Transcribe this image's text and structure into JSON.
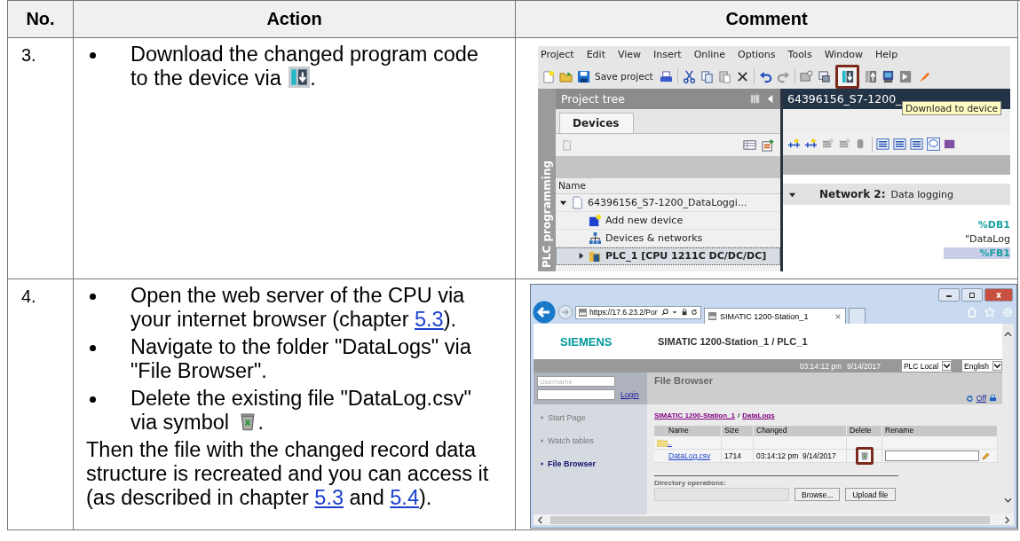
{
  "table": {
    "columns": [
      "No.",
      "Action",
      "Comment"
    ],
    "rows": [
      {
        "number": "3.",
        "bullets": [
          [
            {
              "kind": "text",
              "text": "Download the changed program code to the device via "
            },
            {
              "kind": "icon"
            },
            {
              "kind": "text",
              "text": "."
            }
          ]
        ],
        "paragraphs": [],
        "comment": {
          "kind": "tia",
          "menu": [
            "Project",
            "Edit",
            "View",
            "Insert",
            "Online",
            "Options",
            "Tools",
            "Window",
            "Help"
          ],
          "save_label": "Save project",
          "download_highlighted": true,
          "tooltip": "Download to device",
          "side_tab": "PLC programming",
          "tree_title": "Project tree",
          "tree_tab": "Devices",
          "tree_column": "Name",
          "tree": [
            {
              "kind": "project",
              "label": "64396156_S7-1200_DataLoggi...",
              "expanded": true,
              "selected": false,
              "children": [
                {
                  "kind": "add-device",
                  "label": "Add new device",
                  "selected": false
                },
                {
                  "kind": "network",
                  "label": "Devices & networks",
                  "selected": false
                },
                {
                  "kind": "plc",
                  "label": "PLC_1 [CPU 1211C DC/DC/DC]",
                  "expanded": false,
                  "selected": true
                }
              ]
            }
          ],
          "editor_title": "64396156_S7-1200_",
          "network_label": "Network 2:",
          "network_title": "Data logging",
          "network_expanded": true,
          "operands": [
            "%DB1",
            "\"DataLog",
            "%FB1"
          ]
        }
      },
      {
        "number": "4.",
        "bullets": [
          [
            {
              "kind": "text",
              "text": "Open the web server of the CPU via your internet browser (chapter "
            },
            {
              "kind": "link",
              "text": "5.3"
            },
            {
              "kind": "text",
              "text": ")."
            }
          ],
          [
            {
              "kind": "text",
              "text": "Navigate to the folder \"DataLogs\" via \"File Browser\"."
            }
          ],
          [
            {
              "kind": "text",
              "text": "Delete the existing file \"DataLog.csv\" via symbol "
            },
            {
              "kind": "icon"
            },
            {
              "kind": "text",
              "text": "."
            }
          ]
        ],
        "paragraphs": [
          [
            {
              "kind": "text",
              "text": "Then the file with the changed record data structure is recreated and you can access it (as described in chapter "
            },
            {
              "kind": "link",
              "text": "5.3"
            },
            {
              "kind": "text",
              "text": " and "
            },
            {
              "kind": "link",
              "text": "5.4"
            },
            {
              "kind": "text",
              "text": ")."
            }
          ]
        ],
        "comment": {
          "kind": "browser",
          "address": "https://17.6.23.2/Por",
          "tab": "SIMATIC 1200-Station_1",
          "logo": "SIEMENS",
          "page_title": "SIMATIC 1200-Station_1 / PLC_1",
          "time": "03:14:12 pm",
          "date": "9/14/2017",
          "selects": [
            "PLC Local",
            "English"
          ],
          "username_placeholder": "Username",
          "login": "Login",
          "nav": [
            {
              "label": "Start Page",
              "selected": false
            },
            {
              "label": "Watch tables",
              "selected": false
            },
            {
              "label": "File Browser",
              "selected": true
            }
          ],
          "content_title": "File Browser",
          "refresh_link": "Off",
          "breadcrumb": [
            "SIMATIC 1200-Station_1",
            "DataLogs"
          ],
          "breadcrumb_separator": "/",
          "file_columns": [
            "Name",
            "Size",
            "Changed",
            "Delete",
            "Rename"
          ],
          "files": [
            {
              "kind": "folder",
              "name": ".."
            },
            {
              "kind": "file",
              "name": "DataLog.csv",
              "size": "1714",
              "changed": "03:14:12 pm  9/14/2017",
              "delete_highlighted": true
            }
          ],
          "directory_label": "Directory operations:",
          "browse": "Browse...",
          "upload": "Upload file"
        }
      }
    ]
  }
}
